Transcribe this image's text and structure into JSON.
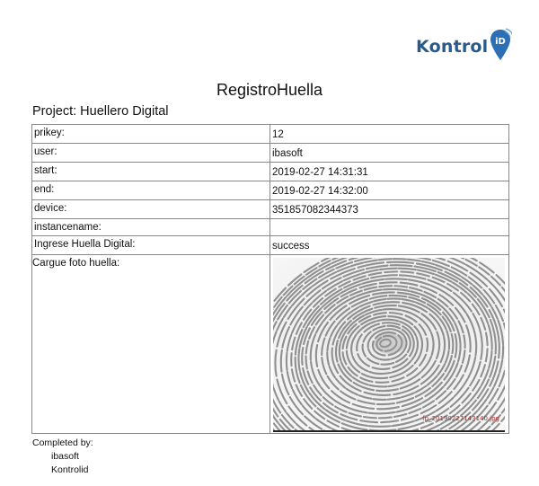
{
  "logo": {
    "text": "Kontrol",
    "mark": "iD",
    "brand_color": "#2a5a8a",
    "pin_color": "#2c6fb5"
  },
  "title": "RegistroHuella",
  "project": "Project: Huellero Digital",
  "rows": [
    {
      "key": "prikey:",
      "value": "12"
    },
    {
      "key": "user:",
      "value": "ibasoft"
    },
    {
      "key": "start:",
      "value": "2019-02-27 14:31:31"
    },
    {
      "key": "end:",
      "value": "2019-02-27 14:32:00"
    },
    {
      "key": "device:",
      "value": "351857082344373"
    },
    {
      "key": "instancename:",
      "value": ""
    },
    {
      "key": "Ingrese Huella Digital:",
      "value": "success"
    }
  ],
  "photo": {
    "key": "Cargue foto huella:",
    "caption": "fp_20190227143140.jpg",
    "icon": "fingerprint-image"
  },
  "completed": {
    "label": "Completed by:",
    "names": [
      "ibasoft",
      "Kontrolid"
    ]
  }
}
